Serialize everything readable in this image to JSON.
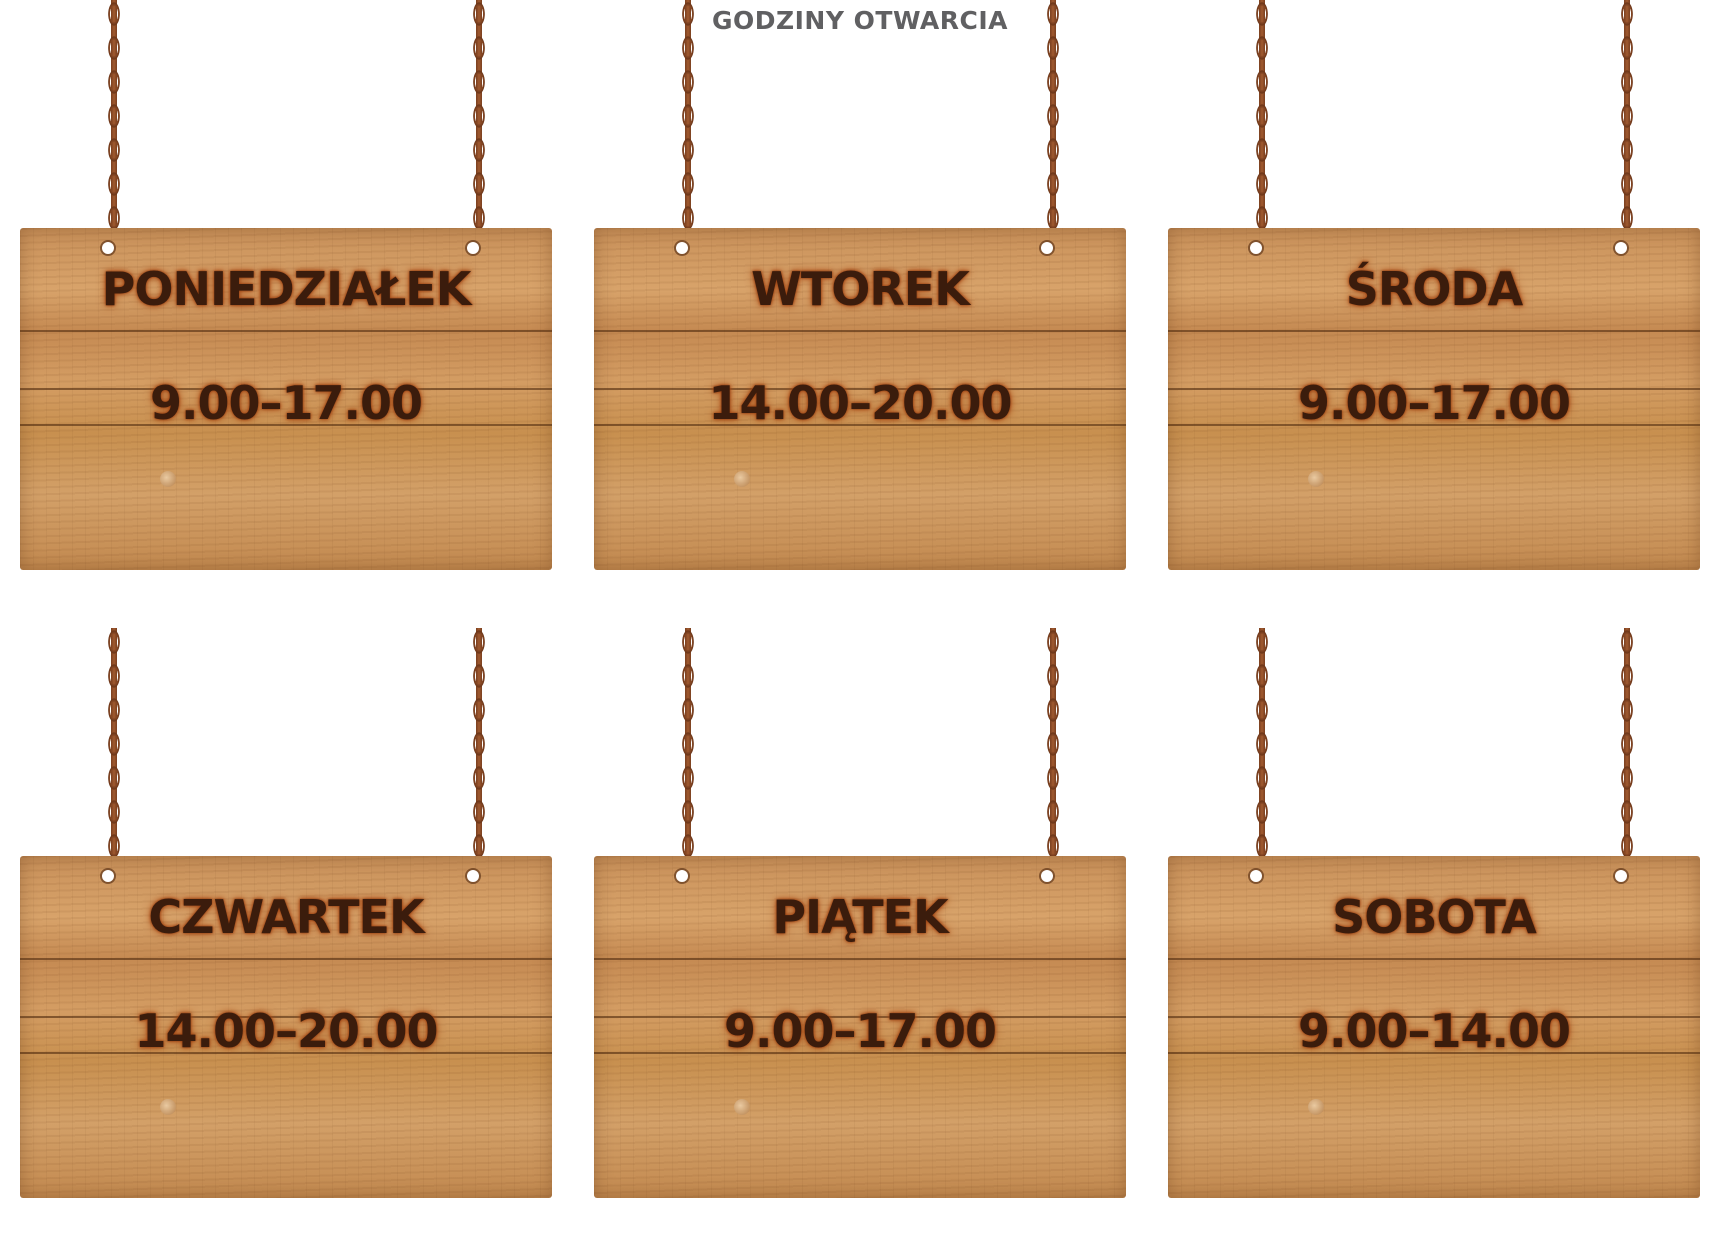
{
  "header": {
    "title": "GODZINY OTWARCIA"
  },
  "signs": [
    {
      "day": "PONIEDZIAŁEK",
      "hours": "9.00–17.00"
    },
    {
      "day": "WTOREK",
      "hours": "14.00–20.00"
    },
    {
      "day": "ŚRODA",
      "hours": "9.00–17.00"
    },
    {
      "day": "CZWARTEK",
      "hours": "14.00–20.00"
    },
    {
      "day": "PIĄTEK",
      "hours": "9.00–17.00"
    },
    {
      "day": "SOBOTA",
      "hours": "9.00–14.00"
    }
  ],
  "colors": {
    "title": "#606062",
    "wood": "#d09a60",
    "burnt_text": "#3b1c0c",
    "chain": "#7a3f1f"
  }
}
